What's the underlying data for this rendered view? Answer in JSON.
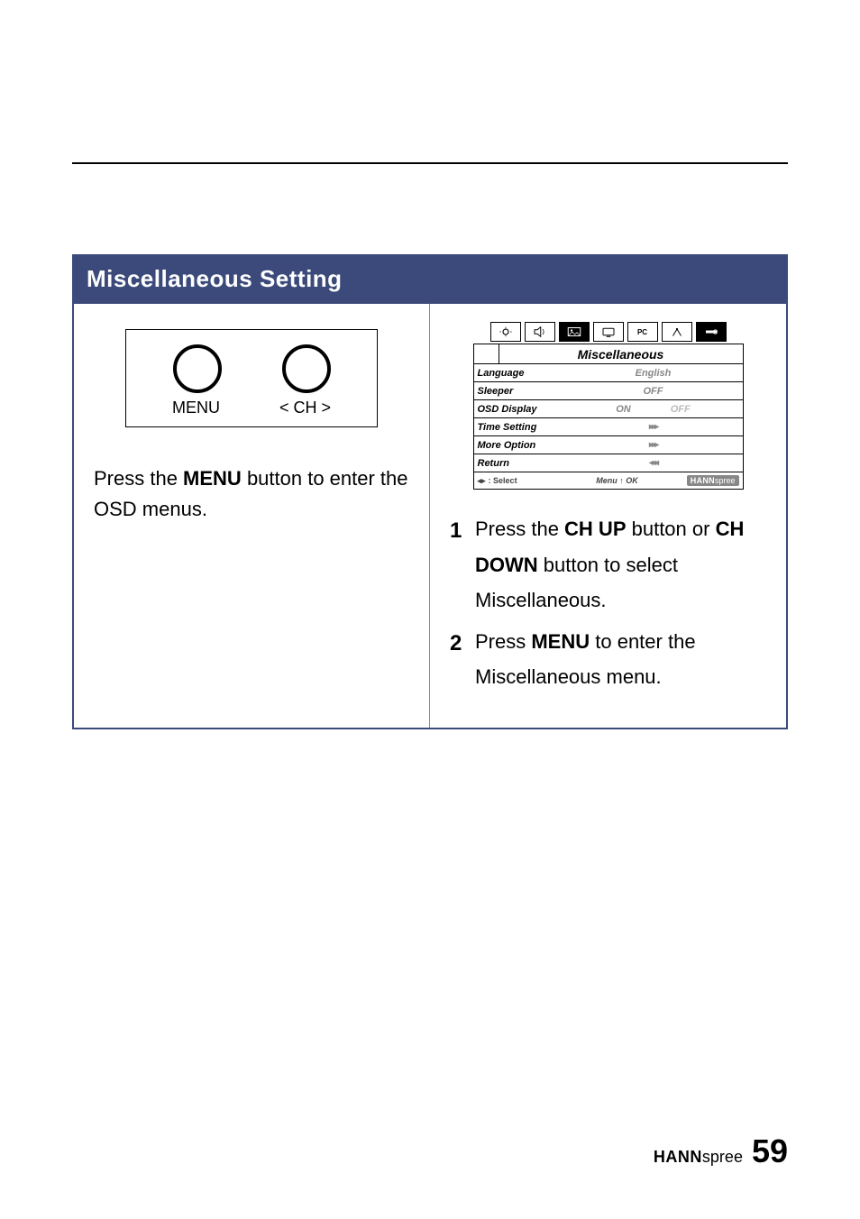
{
  "section": {
    "title": "Miscellaneous Setting"
  },
  "remote": {
    "menu_label": "MENU",
    "ch_label": "<  CH  >"
  },
  "left_instruction": {
    "pre": "Press the ",
    "bold": "MENU",
    "post": " button to enter the OSD menus."
  },
  "osd": {
    "tabs": {
      "pc": "PC"
    },
    "title": "Miscellaneous",
    "rows": {
      "language": {
        "label": "Language",
        "value": "English"
      },
      "sleeper": {
        "label": "Sleeper",
        "value": "OFF"
      },
      "osd_display": {
        "label": "OSD Display",
        "on": "ON",
        "off": "OFF"
      },
      "time_setting": {
        "label": "Time Setting",
        "arrow": "▸▸▸"
      },
      "more_option": {
        "label": "More Option",
        "arrow": "▸▸▸"
      },
      "return": {
        "label": "Return",
        "arrow": "◂◂◂"
      }
    },
    "footer": {
      "select": ": Select",
      "menu_ok": "Menu ↑ OK",
      "brand_hn": "HANN",
      "brand_sp": "spree"
    }
  },
  "steps": {
    "s1": {
      "num": "1",
      "t1": "Press the ",
      "b1": "CH UP",
      "t2": " button or ",
      "b2": "CH DOWN",
      "t3": " button to select Miscellaneous."
    },
    "s2": {
      "num": "2",
      "t1": "Press ",
      "b1": "MENU",
      "t2": " to enter the Miscellaneous menu."
    }
  },
  "footer": {
    "brand_hn": "HANN",
    "brand_sp": "spree",
    "page_num": "59"
  }
}
